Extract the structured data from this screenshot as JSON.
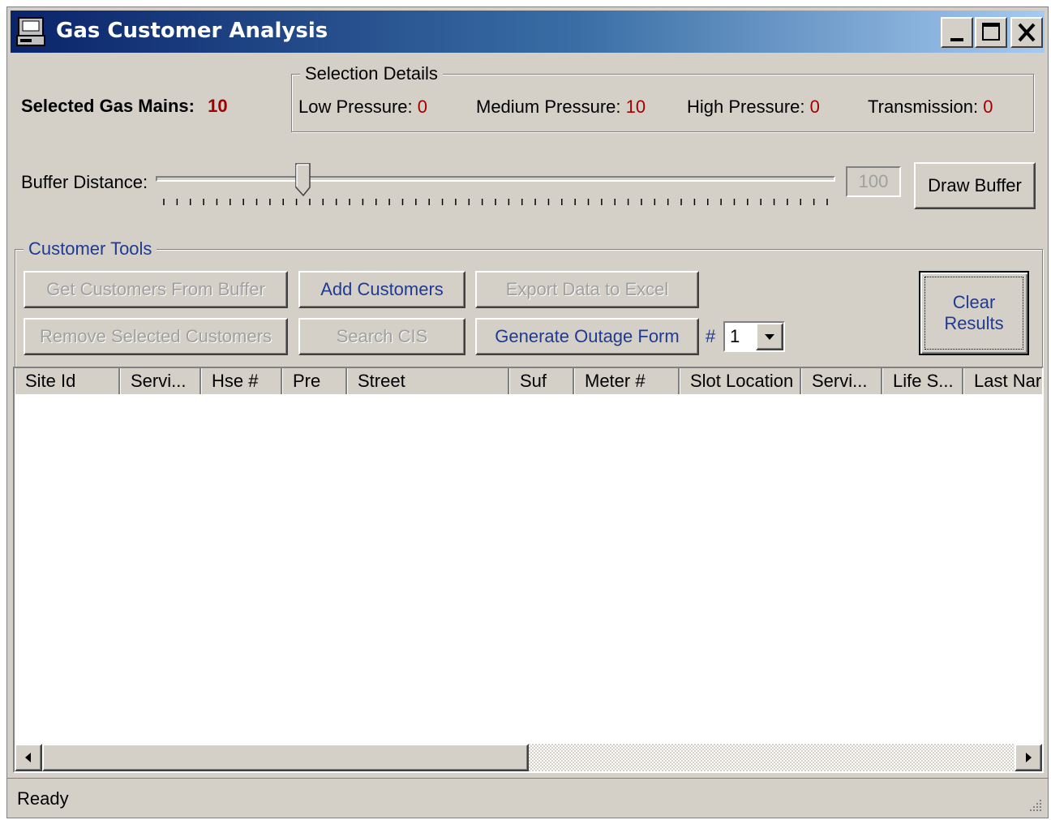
{
  "window": {
    "title": "Gas Customer Analysis"
  },
  "selection": {
    "selected_label": "Selected Gas Mains:",
    "selected_value": "10",
    "group_title": "Selection Details",
    "low_label": "Low Pressure:",
    "low_value": "0",
    "medium_label": "Medium Pressure:",
    "medium_value": "10",
    "high_label": "High Pressure:",
    "high_value": "0",
    "transmission_label": "Transmission:",
    "transmission_value": "0"
  },
  "buffer": {
    "label": "Buffer Distance:",
    "slider_fraction": 0.21,
    "value": "100",
    "draw_button": "Draw Buffer"
  },
  "tools": {
    "group_title": "Customer Tools",
    "get_customers": "Get Customers From Buffer",
    "add_customers": "Add Customers",
    "export_excel": "Export Data to Excel",
    "remove_selected": "Remove Selected Customers",
    "search_cis": "Search CIS",
    "generate_outage": "Generate Outage Form",
    "hash_label": "#",
    "form_number": "1",
    "clear_line1": "Clear",
    "clear_line2": "Results"
  },
  "table": {
    "columns": [
      "Site Id",
      "Servi...",
      "Hse #",
      "Pre",
      "Street",
      "Suf",
      "Meter #",
      "Slot Location",
      "Servi...",
      "Life S...",
      "Last Nar"
    ],
    "scroll_thumb_fraction": 0.5
  },
  "status": {
    "text": "Ready"
  }
}
